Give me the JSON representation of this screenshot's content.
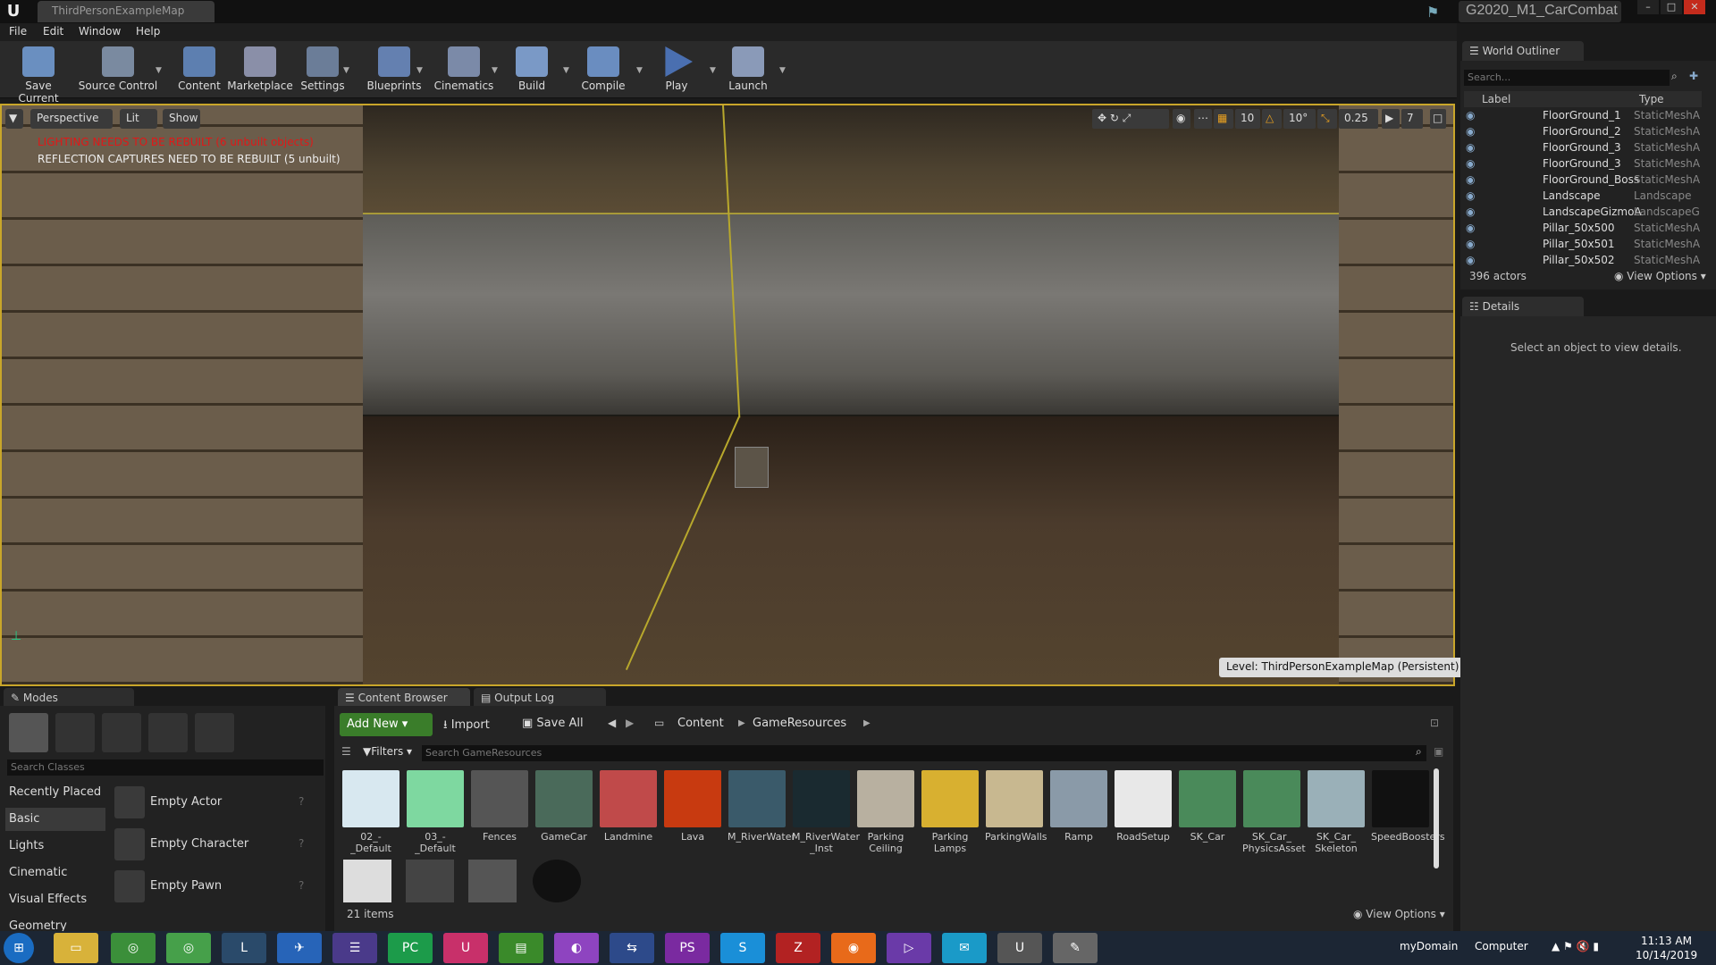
{
  "window": {
    "tab_title": "ThirdPersonExampleMap",
    "project": "G2020_M1_CarCombat"
  },
  "menu": [
    "File",
    "Edit",
    "Window",
    "Help"
  ],
  "toolbar": [
    "Save Current",
    "Source Control",
    "Content",
    "Marketplace",
    "Settings",
    "Blueprints",
    "Cinematics",
    "Build",
    "Compile",
    "Play",
    "Launch"
  ],
  "viewport": {
    "perspective": "Perspective",
    "lit": "Lit",
    "show": "Show",
    "warn_lighting": "LIGHTING NEEDS TO BE REBUILT (6 unbuilt objects)",
    "warn_reflection": "REFLECTION CAPTURES NEED TO BE REBUILT (5 unbuilt)",
    "level": "Level:  ThirdPersonExampleMap (Persistent)",
    "grid": "10",
    "rot": "10°",
    "scale": "0.25",
    "cam": "7"
  },
  "outliner": {
    "tab": "World Outliner",
    "search": "Search...",
    "col_label": "Label",
    "col_type": "Type",
    "count": "396 actors",
    "view_options": "View Options",
    "rows": [
      {
        "n": "FloorGround_1",
        "t": "StaticMeshA"
      },
      {
        "n": "FloorGround_2",
        "t": "StaticMeshA"
      },
      {
        "n": "FloorGround_3",
        "t": "StaticMeshA"
      },
      {
        "n": "FloorGround_3",
        "t": "StaticMeshA"
      },
      {
        "n": "FloorGround_Boss",
        "t": "StaticMeshA"
      },
      {
        "n": "Landscape",
        "t": "Landscape"
      },
      {
        "n": "LandscapeGizmoA",
        "t": "LandscapeG"
      },
      {
        "n": "Pillar_50x500",
        "t": "StaticMeshA"
      },
      {
        "n": "Pillar_50x501",
        "t": "StaticMeshA"
      },
      {
        "n": "Pillar_50x502",
        "t": "StaticMeshA"
      }
    ]
  },
  "details": {
    "tab": "Details",
    "empty": "Select an object to view details."
  },
  "modes": {
    "tab": "Modes",
    "search": "Search Classes",
    "cats": [
      "Recently Placed",
      "Basic",
      "Lights",
      "Cinematic",
      "Visual Effects",
      "Geometry"
    ],
    "items": [
      "Empty Actor",
      "Empty Character",
      "Empty Pawn"
    ]
  },
  "cb": {
    "tab1": "Content Browser",
    "tab2": "Output Log",
    "add_new": "Add New",
    "import": "Import",
    "save_all": "Save All",
    "path1": "Content",
    "path2": "GameResources",
    "filters": "Filters",
    "search": "Search GameResources",
    "count": "21 items",
    "view_options": "View Options",
    "assets": [
      "02_-_Default",
      "03_-_Default",
      "Fences",
      "GameCar",
      "Landmine",
      "Lava",
      "M_RiverWater",
      "M_RiverWater _Inst",
      "Parking Ceiling",
      "Parking Lamps",
      "ParkingWalls",
      "Ramp",
      "RoadSetup",
      "SK_Car",
      "SK_Car_ PhysicsAsset",
      "SK_Car_ Skeleton",
      "SpeedBoosters"
    ]
  },
  "taskbar": {
    "domain": "myDomain",
    "computer": "Computer",
    "time": "11:13 AM",
    "date": "10/14/2019"
  }
}
